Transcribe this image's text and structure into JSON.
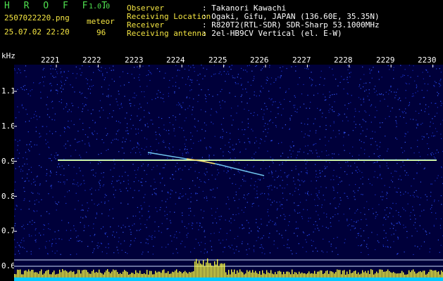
{
  "app": {
    "name": "H R O F F T",
    "version": "1.0.0"
  },
  "file": {
    "name": "2507022220.png",
    "datetime": "25.07.02 22:20"
  },
  "meteor": {
    "label": "meteor",
    "count": "96"
  },
  "info": [
    {
      "key": "Observer",
      "value": ": Takanori Kawachi"
    },
    {
      "key": "Receiving Location",
      "value": ": Ogaki, Gifu, JAPAN (136.60E, 35.35N)"
    },
    {
      "key": "Receiver",
      "value": ": R820T2(RTL-SDR) SDR-Sharp 53.1000MHz"
    },
    {
      "key": "Receiving antenna",
      "value": ": 2el-HB9CV Vertical (el. E-W)"
    }
  ],
  "axis": {
    "unit": "kHz",
    "x_ticks": [
      "2221",
      "2222",
      "2223",
      "2224",
      "2225",
      "2226",
      "2227",
      "2228",
      "2229",
      "2230"
    ],
    "y_ticks": [
      "1.1",
      "1.0",
      "0.9",
      "0.8",
      "0.7",
      "0.6"
    ]
  },
  "colors": {
    "header_yellow": "#f5e642",
    "title_green": "#4fe04f",
    "carrier": "#b8f5d0",
    "noise": "#1a2fc8",
    "level_bar": "#f5f542",
    "level_base": "#00c8ff"
  }
}
